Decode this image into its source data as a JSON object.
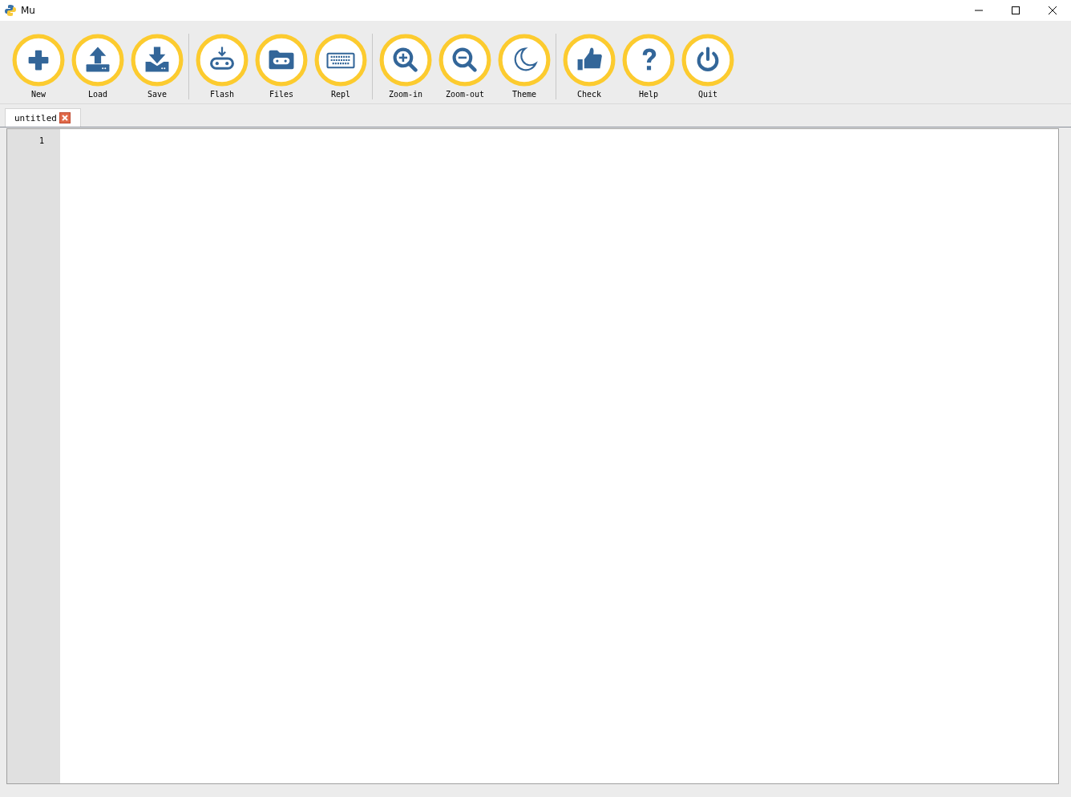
{
  "window": {
    "title": "Mu"
  },
  "toolbar": [
    [
      {
        "label": "New",
        "kind": "new"
      },
      {
        "label": "Load",
        "kind": "load"
      },
      {
        "label": "Save",
        "kind": "save"
      }
    ],
    [
      {
        "label": "Flash",
        "kind": "flash"
      },
      {
        "label": "Files",
        "kind": "files"
      },
      {
        "label": "Repl",
        "kind": "repl"
      }
    ],
    [
      {
        "label": "Zoom-in",
        "kind": "zoomin"
      },
      {
        "label": "Zoom-out",
        "kind": "zoomout"
      },
      {
        "label": "Theme",
        "kind": "theme"
      }
    ],
    [
      {
        "label": "Check",
        "kind": "check"
      },
      {
        "label": "Help",
        "kind": "help"
      },
      {
        "label": "Quit",
        "kind": "quit"
      }
    ]
  ],
  "tabs": [
    {
      "label": "untitled",
      "selected": true
    }
  ],
  "editor": {
    "line_numbers": [
      "1"
    ]
  }
}
